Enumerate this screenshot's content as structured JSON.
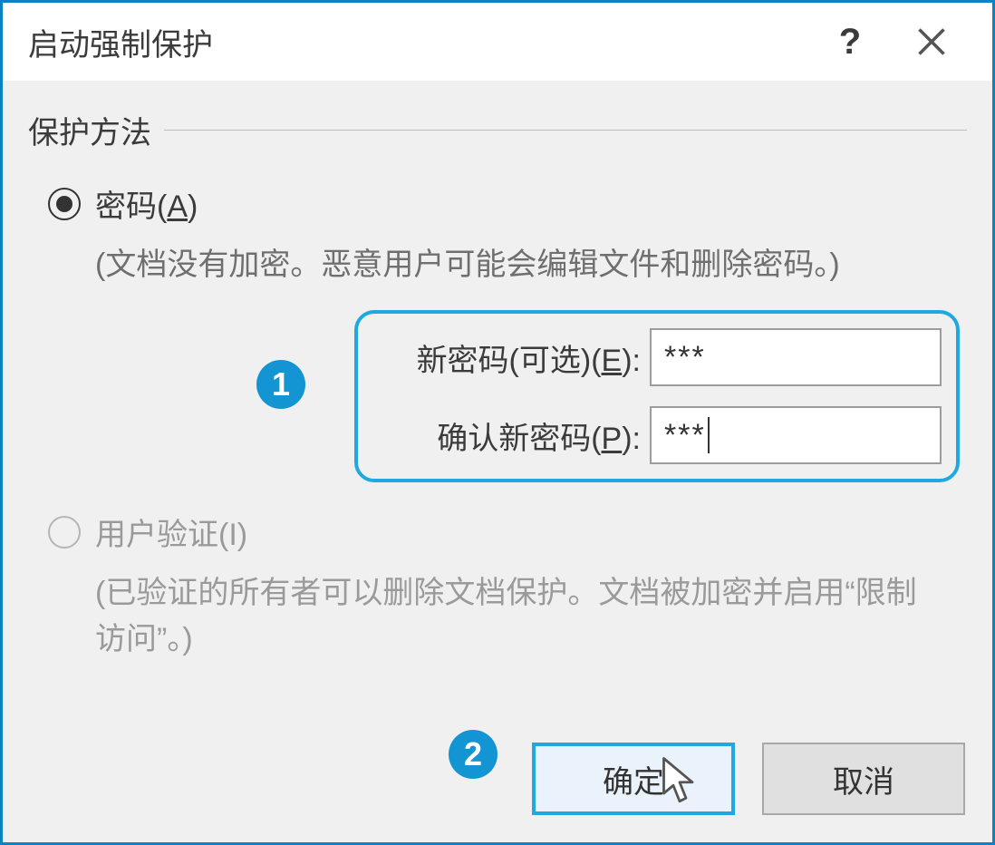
{
  "dialog": {
    "title": "启动强制保护",
    "help_tooltip": "?",
    "close_tooltip": "×"
  },
  "section": {
    "header": "保护方法"
  },
  "password_option": {
    "label_prefix": "密码(",
    "mnemonic": "A",
    "label_suffix": ")",
    "hint": "(文档没有加密。恶意用户可能会编辑文件和删除密码。)",
    "new_pw_label_prefix": "新密码(可选)(",
    "new_pw_mnemonic": "E",
    "new_pw_label_suffix": "):",
    "new_pw_value": "***",
    "confirm_pw_label_prefix": "确认新密码(",
    "confirm_pw_mnemonic": "P",
    "confirm_pw_label_suffix": "):",
    "confirm_pw_value": "***"
  },
  "user_auth_option": {
    "label": "用户验证(I)",
    "hint": "(已验证的所有者可以删除文档保护。文档被加密并启用“限制访问”。)"
  },
  "buttons": {
    "ok": "确定",
    "cancel": "取消"
  },
  "annotations": {
    "one": "1",
    "two": "2"
  }
}
